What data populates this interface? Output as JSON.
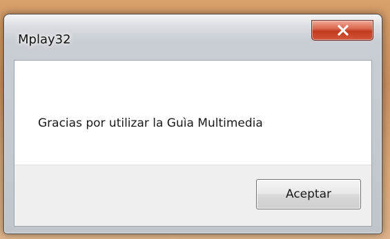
{
  "window": {
    "title": "Mplay32",
    "close_icon": "close-icon"
  },
  "dialog": {
    "message": "Gracias por utilizar la Guìa Multimedia",
    "ok_label": "Aceptar"
  }
}
